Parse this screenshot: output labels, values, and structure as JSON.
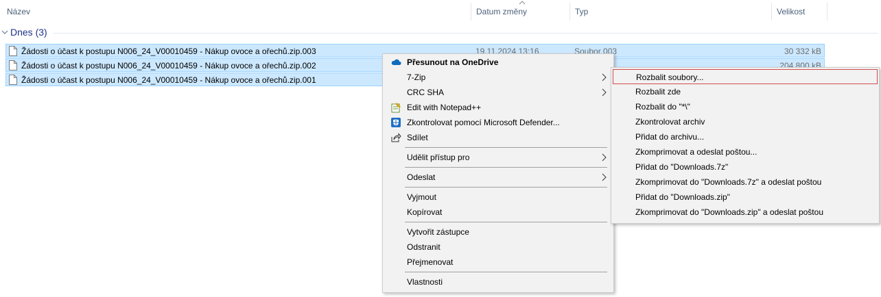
{
  "columns": {
    "name": "Název",
    "date": "Datum změny",
    "type": "Typ",
    "size": "Velikost"
  },
  "group": {
    "label": "Dnes (3)"
  },
  "files": [
    {
      "name": "Žádosti o účast k postupu N006_24_V00010459 - Nákup ovoce a ořechů.zip.003",
      "date": "19.11.2024 13:16",
      "type": "Soubor 003",
      "size": "30 332 kB"
    },
    {
      "name": "Žádosti o účast k postupu N006_24_V00010459 - Nákup ovoce a ořechů.zip.002",
      "date": "",
      "type": "",
      "size": "204 800 kB"
    },
    {
      "name": "Žádosti o účast k postupu N006_24_V00010459 - Nákup ovoce a ořechů.zip.001",
      "date": "",
      "type": "",
      "size": ""
    }
  ],
  "context_menu": {
    "items": [
      {
        "label": "Přesunout na OneDrive",
        "icon": "onedrive-icon"
      },
      {
        "label": "7-Zip",
        "submenu": true
      },
      {
        "label": "CRC SHA",
        "submenu": true
      },
      {
        "label": "Edit with Notepad++",
        "icon": "notepad-plus-plus-icon"
      },
      {
        "label": "Zkontrolovat pomocí Microsoft Defender...",
        "icon": "defender-shield-icon"
      },
      {
        "label": "Sdílet",
        "icon": "share-icon"
      },
      {
        "label": "Udělit přístup pro",
        "submenu": true
      },
      {
        "label": "Odeslat",
        "submenu": true
      },
      {
        "label": "Vyjmout"
      },
      {
        "label": "Kopírovat"
      },
      {
        "label": "Vytvořit zástupce"
      },
      {
        "label": "Odstranit"
      },
      {
        "label": "Přejmenovat"
      },
      {
        "label": "Vlastnosti"
      }
    ]
  },
  "submenu_7zip": {
    "items": [
      {
        "label": "Rozbalit soubory..."
      },
      {
        "label": "Rozbalit zde"
      },
      {
        "label": "Rozbalit do \"*\\\""
      },
      {
        "label": "Zkontrolovat archiv"
      },
      {
        "label": "Přidat do archivu..."
      },
      {
        "label": "Zkomprimovat a odeslat poštou..."
      },
      {
        "label": "Přidat do \"Downloads.7z\""
      },
      {
        "label": "Zkomprimovat do \"Downloads.7z\" a odeslat poštou"
      },
      {
        "label": "Přidat do \"Downloads.zip\""
      },
      {
        "label": "Zkomprimovat do \"Downloads.zip\" a odeslat poštou"
      }
    ]
  },
  "colors": {
    "selection_bg": "#cce8ff",
    "selection_border": "#99d1ff",
    "highlight_border": "#d04a4a",
    "group_label": "#1e3287"
  }
}
